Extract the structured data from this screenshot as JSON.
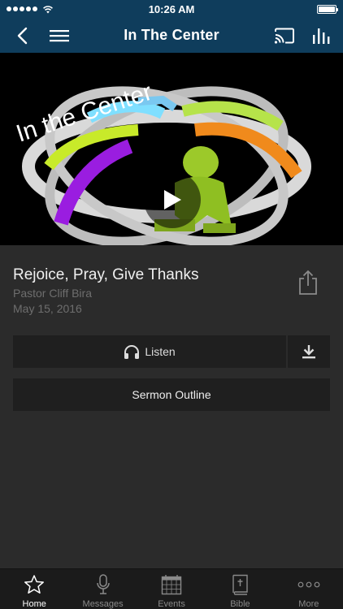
{
  "status_bar": {
    "time": "10:26 AM"
  },
  "nav": {
    "title": "In The Center"
  },
  "hero": {
    "artwork_text": "In the Center"
  },
  "sermon": {
    "title": "Rejoice, Pray, Give Thanks",
    "speaker": "Pastor Cliff Bira",
    "date": "May 15, 2016"
  },
  "actions": {
    "listen_label": "Listen",
    "outline_label": "Sermon Outline"
  },
  "tabs": [
    {
      "label": "Home",
      "icon": "star-icon",
      "active": true
    },
    {
      "label": "Messages",
      "icon": "microphone-icon",
      "active": false
    },
    {
      "label": "Events",
      "icon": "calendar-icon",
      "active": false
    },
    {
      "label": "Bible",
      "icon": "bible-icon",
      "active": false
    },
    {
      "label": "More",
      "icon": "more-dots-icon",
      "active": false
    }
  ],
  "colors": {
    "nav_background": "#0f3d5c",
    "page_background": "#2b2b2b",
    "button_background": "#1f1f1f",
    "muted_text": "#6e6e6e"
  }
}
